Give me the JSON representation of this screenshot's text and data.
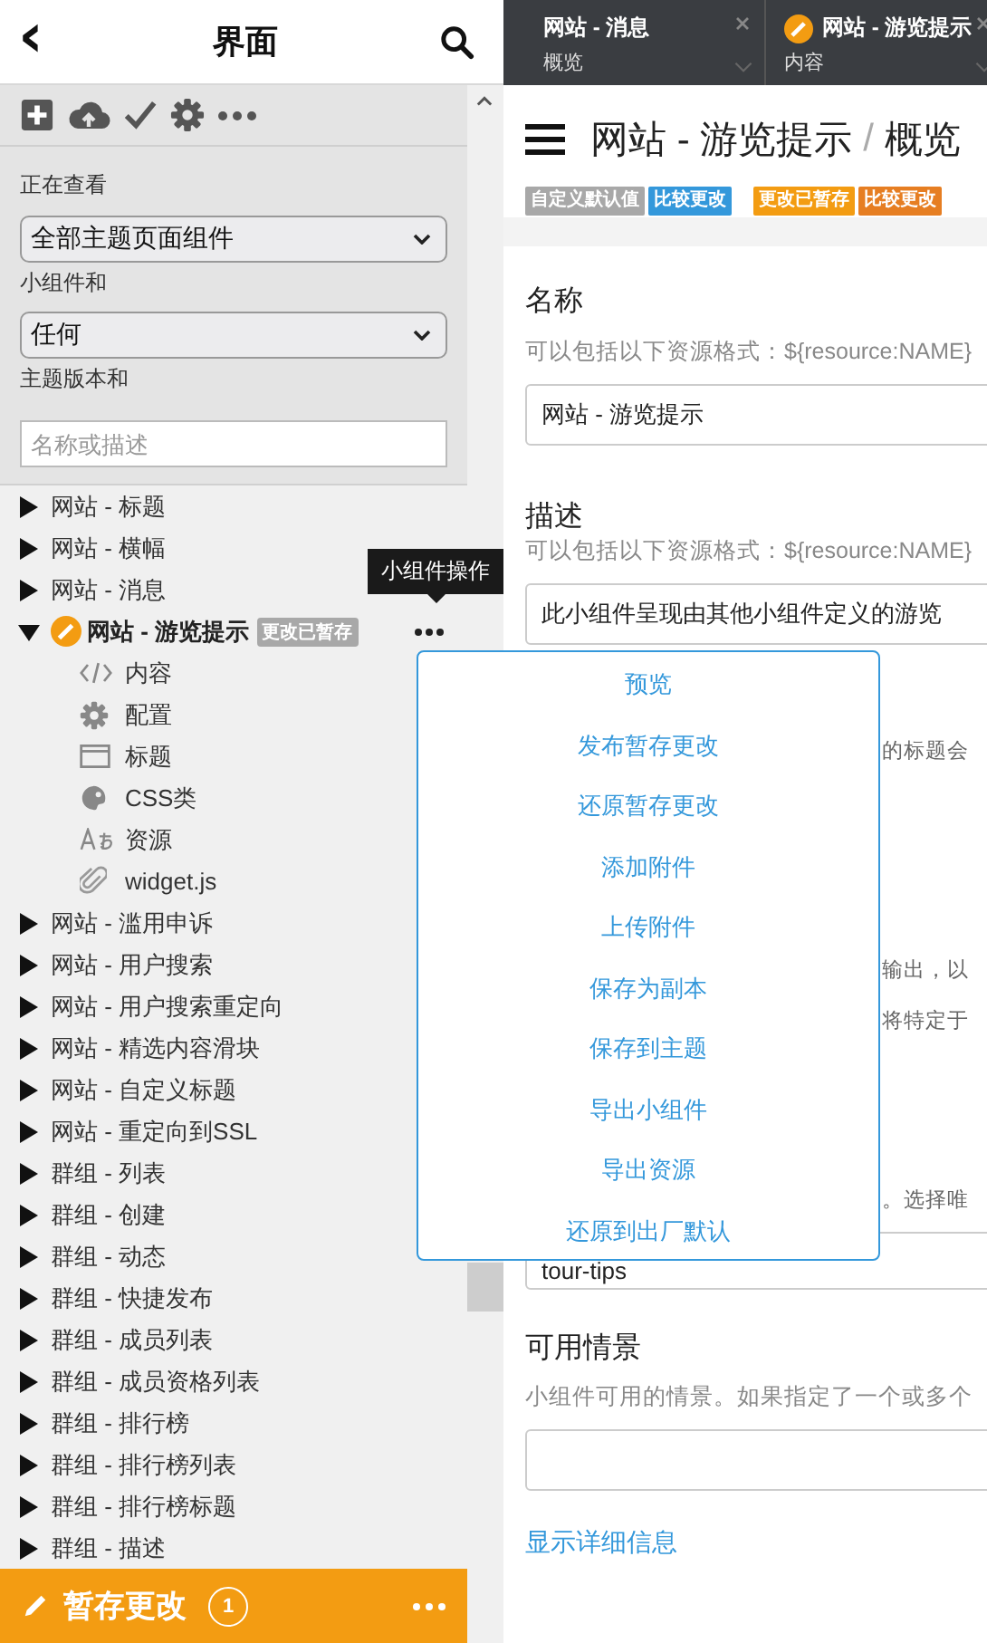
{
  "sidebar": {
    "back": "‹",
    "title": "界面",
    "filters": {
      "viewing_label": "正在查看",
      "scope_select": "全部主题页面组件",
      "widgets_label": "小组件和",
      "version_select": "任何",
      "theme_label": "主题版本和",
      "search": {
        "placeholder": "名称或描述"
      }
    },
    "tree": [
      {
        "label": "网站 - 标题",
        "expanded": false,
        "modified": false
      },
      {
        "label": "网站 - 横幅",
        "expanded": false,
        "modified": false
      },
      {
        "label": "网站 - 消息",
        "expanded": false,
        "modified": false
      },
      {
        "label": "网站 - 游览提示",
        "expanded": true,
        "modified": true,
        "badge": "更改已暂存",
        "children": [
          {
            "label": "内容",
            "kind": "code"
          },
          {
            "label": "配置",
            "kind": "gear"
          },
          {
            "label": "标题",
            "kind": "window"
          },
          {
            "label": "CSS类",
            "kind": "palette"
          },
          {
            "label": "资源",
            "kind": "font"
          },
          {
            "label": "widget.js",
            "kind": "clip"
          }
        ]
      },
      {
        "label": "网站 - 滥用申诉",
        "expanded": false,
        "modified": false
      },
      {
        "label": "网站 - 用户搜索",
        "expanded": false,
        "modified": false
      },
      {
        "label": "网站 - 用户搜索重定向",
        "expanded": false,
        "modified": false
      },
      {
        "label": "网站 - 精选内容滑块",
        "expanded": false,
        "modified": false
      },
      {
        "label": "网站 - 自定义标题",
        "expanded": false,
        "modified": false
      },
      {
        "label": "网站 - 重定向到SSL",
        "expanded": false,
        "modified": false
      },
      {
        "label": "群组 - 列表",
        "expanded": false,
        "modified": false
      },
      {
        "label": "群组 - 创建",
        "expanded": false,
        "modified": false
      },
      {
        "label": "群组 - 动态",
        "expanded": false,
        "modified": false
      },
      {
        "label": "群组 - 快捷发布",
        "expanded": false,
        "modified": false
      },
      {
        "label": "群组 - 成员列表",
        "expanded": false,
        "modified": false
      },
      {
        "label": "群组 - 成员资格列表",
        "expanded": false,
        "modified": false
      },
      {
        "label": "群组 - 排行榜",
        "expanded": false,
        "modified": false
      },
      {
        "label": "群组 - 排行榜列表",
        "expanded": false,
        "modified": false
      },
      {
        "label": "群组 - 排行榜标题",
        "expanded": false,
        "modified": false
      },
      {
        "label": "群组 - 描述",
        "expanded": false,
        "modified": false
      }
    ],
    "staged_bar": {
      "label": "暂存更改",
      "count": "1"
    }
  },
  "tooltip": "小组件操作",
  "actions_menu": [
    "预览",
    "发布暂存更改",
    "还原暂存更改",
    "添加附件",
    "上传附件",
    "保存为副本",
    "保存到主题",
    "导出小组件",
    "导出资源",
    "还原到出厂默认"
  ],
  "tabs": [
    {
      "title": "网站 - 消息",
      "subtitle": "概览",
      "modified": false
    },
    {
      "title": "网站 - 游览提示",
      "subtitle": "内容",
      "modified": true
    }
  ],
  "editor": {
    "path": "网站 - 游览提示",
    "separator": "/",
    "current": "概览",
    "badges": [
      {
        "label": "自定义默认值",
        "color": "#a8a8a8"
      },
      {
        "label": "比较更改",
        "color": "#3498db"
      },
      {
        "label": "更改已暂存",
        "color": "#f39c12"
      },
      {
        "label": "比较更改",
        "color": "#e67e22"
      }
    ],
    "name": {
      "label": "名称",
      "hint": "可以包括以下资源格式：${resource:NAME}",
      "value": "网站 - 游览提示"
    },
    "description": {
      "label": "描述",
      "hint": "可以包括以下资源格式：${resource:NAME}",
      "value": "此小组件呈现由其他小组件定义的游览"
    },
    "partly_hidden_texts": [
      "的标题会",
      "输出，以",
      "将特定于",
      "。选择唯"
    ],
    "css_class_value": "tour-tips",
    "contexts": {
      "label": "可用情景",
      "hint": "小组件可用的情景。如果指定了一个或多个"
    },
    "details_link": "显示详细信息"
  }
}
